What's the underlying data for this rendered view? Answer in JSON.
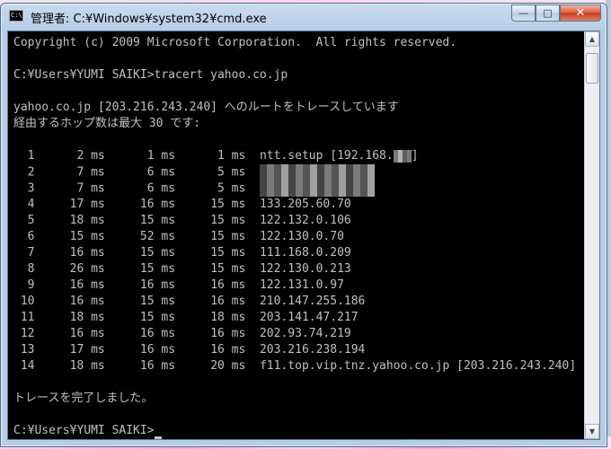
{
  "window": {
    "title": "管理者: C:¥Windows¥system32¥cmd.exe",
    "icon_text": "C:\\",
    "buttons": {
      "minimize": "—",
      "maximize": "□",
      "close": "✕"
    }
  },
  "console": {
    "copyright": "Copyright (c) 2009 Microsoft Corporation.  All rights reserved.",
    "command": "C:¥Users¥YUMI SAIKI>tracert yahoo.co.jp",
    "route_header": "yahoo.co.jp [203.216.243.240] へのルートをトレースしています",
    "max_hops": "経由するホップ数は最大 30 です:",
    "hops": [
      {
        "n": "1",
        "t1": "2 ms",
        "t2": "1 ms",
        "t3": "1 ms",
        "host": "ntt.setup [192.168.",
        "host_tail": "]",
        "masked": "short"
      },
      {
        "n": "2",
        "t1": "7 ms",
        "t2": "6 ms",
        "t3": "5 ms",
        "host": "",
        "host_tail": "",
        "masked": "wide"
      },
      {
        "n": "3",
        "t1": "7 ms",
        "t2": "6 ms",
        "t3": "5 ms",
        "host": "",
        "host_tail": "",
        "masked": "wide"
      },
      {
        "n": "4",
        "t1": "17 ms",
        "t2": "16 ms",
        "t3": "15 ms",
        "host": "133.205.60.70"
      },
      {
        "n": "5",
        "t1": "18 ms",
        "t2": "15 ms",
        "t3": "15 ms",
        "host": "122.132.0.106"
      },
      {
        "n": "6",
        "t1": "15 ms",
        "t2": "52 ms",
        "t3": "15 ms",
        "host": "122.130.0.70"
      },
      {
        "n": "7",
        "t1": "16 ms",
        "t2": "15 ms",
        "t3": "15 ms",
        "host": "111.168.0.209"
      },
      {
        "n": "8",
        "t1": "26 ms",
        "t2": "15 ms",
        "t3": "15 ms",
        "host": "122.130.0.213"
      },
      {
        "n": "9",
        "t1": "16 ms",
        "t2": "16 ms",
        "t3": "16 ms",
        "host": "122.131.0.97"
      },
      {
        "n": "10",
        "t1": "16 ms",
        "t2": "15 ms",
        "t3": "16 ms",
        "host": "210.147.255.186"
      },
      {
        "n": "11",
        "t1": "18 ms",
        "t2": "15 ms",
        "t3": "18 ms",
        "host": "203.141.47.217"
      },
      {
        "n": "12",
        "t1": "16 ms",
        "t2": "16 ms",
        "t3": "16 ms",
        "host": "202.93.74.219"
      },
      {
        "n": "13",
        "t1": "17 ms",
        "t2": "16 ms",
        "t3": "16 ms",
        "host": "203.216.238.194"
      },
      {
        "n": "14",
        "t1": "18 ms",
        "t2": "16 ms",
        "t3": "20 ms",
        "host": "f11.top.vip.tnz.yahoo.co.jp [203.216.243.240]"
      }
    ],
    "complete": "トレースを完了しました。",
    "prompt": "C:¥Users¥YUMI SAIKI>"
  },
  "colors": {
    "console_bg": "#000000",
    "console_fg": "#c0c0c0",
    "close_button": "#c23b1f"
  },
  "icons": {
    "scroll_up": "▲",
    "scroll_down": "▼"
  }
}
